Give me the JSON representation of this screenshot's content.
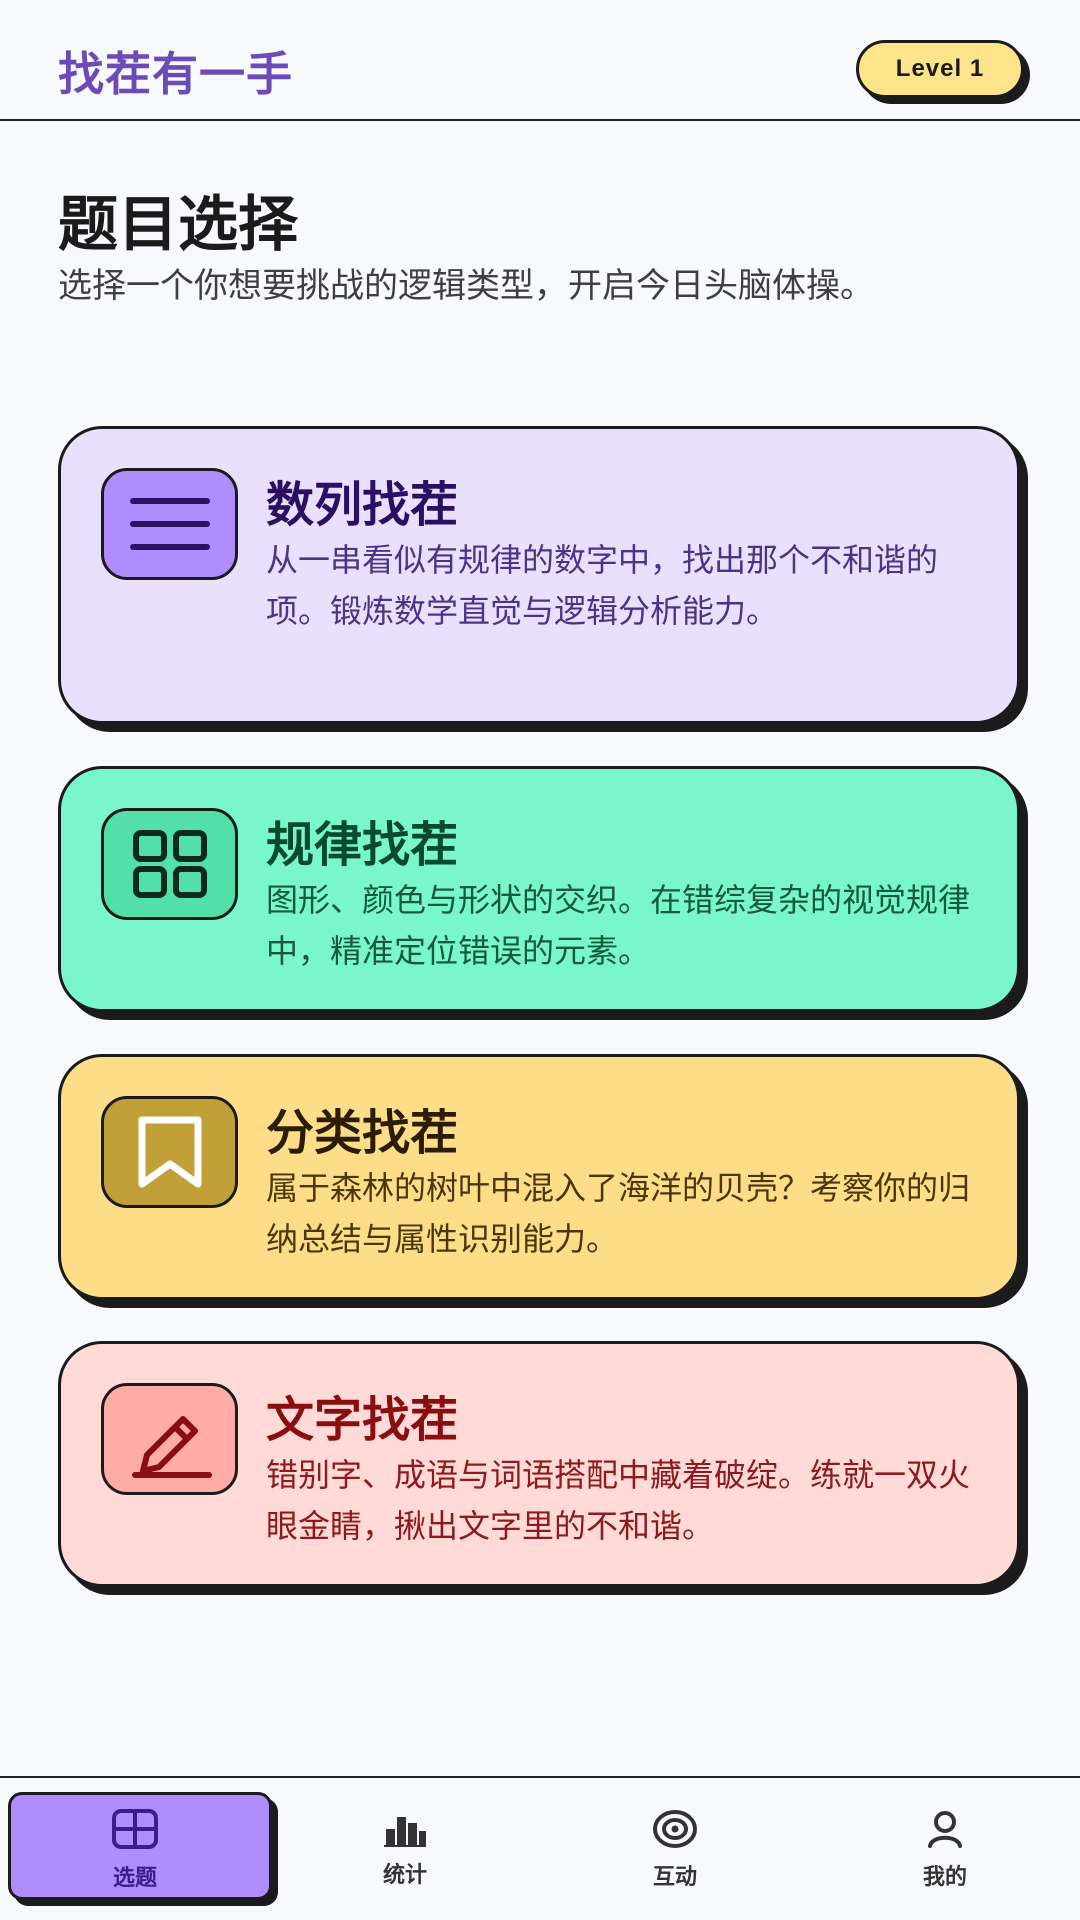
{
  "header": {
    "brand": "找茬有一手",
    "level_badge": "Level 1"
  },
  "intro": {
    "title": "题目选择",
    "subtitle": "选择一个你想要挑战的逻辑类型，开启今日头脑体操。"
  },
  "cards": [
    {
      "icon": "menu-lines-icon",
      "title": "数列找茬",
      "description": "从一串看似有规律的数字中，找出那个不和谐的项。锻炼数学直觉与逻辑分析能力。",
      "color": "#e8e0fd"
    },
    {
      "icon": "grid-icon",
      "title": "规律找茬",
      "description": "图形、颜色与形状的交织。在错综复杂的视觉规律中，精准定位错误的元素。",
      "color": "#79f6cc"
    },
    {
      "icon": "bookmark-icon",
      "title": "分类找茬",
      "description": "属于森林的树叶中混入了海洋的贝壳？考察你的归纳总结与属性识别能力。",
      "color": "#fddd88"
    },
    {
      "icon": "pencil-edit-icon",
      "title": "文字找茬",
      "description": "错别字、成语与词语搭配中藏着破绽。练就一双火眼金睛，揪出文字里的不和谐。",
      "color": "#ffdad7"
    }
  ],
  "bottom_nav": [
    {
      "icon": "grid-select-icon",
      "label": "选题",
      "active": true
    },
    {
      "icon": "bar-chart-icon",
      "label": "统计",
      "active": false
    },
    {
      "icon": "target-icon",
      "label": "互动",
      "active": false
    },
    {
      "icon": "person-icon",
      "label": "我的",
      "active": false
    }
  ]
}
